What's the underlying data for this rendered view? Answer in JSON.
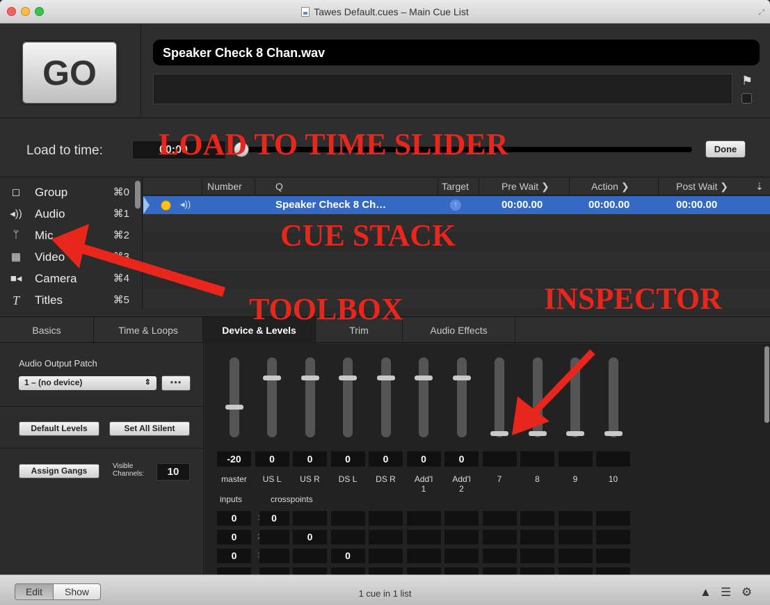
{
  "window": {
    "title": "Tawes Default.cues – Main Cue List"
  },
  "top": {
    "go_label": "GO",
    "cue_name": "Speaker Check 8 Chan.wav",
    "notes": ""
  },
  "load": {
    "label": "Load to time:",
    "time_value": "00:00",
    "slider_fraction": 0.0,
    "done_label": "Done"
  },
  "toolbox": {
    "items": [
      {
        "icon": "group-icon",
        "label": "Group",
        "shortcut": "⌘0"
      },
      {
        "icon": "audio-icon",
        "label": "Audio",
        "shortcut": "⌘1"
      },
      {
        "icon": "mic-icon",
        "label": "Mic",
        "shortcut": "⌘2"
      },
      {
        "icon": "video-icon",
        "label": "Video",
        "shortcut": "⌘3"
      },
      {
        "icon": "camera-icon",
        "label": "Camera",
        "shortcut": "⌘4"
      },
      {
        "icon": "titles-icon",
        "label": "Titles",
        "shortcut": "⌘5"
      }
    ]
  },
  "cue_stack": {
    "headers": [
      "Number",
      "Q",
      "Target",
      "Pre Wait",
      "Action",
      "Post Wait"
    ],
    "rows": [
      {
        "number": "",
        "q": "Speaker Check 8 Ch…",
        "pre_wait": "00:00.00",
        "action": "00:00.00",
        "post_wait": "00:00.00",
        "selected": true
      }
    ]
  },
  "inspector": {
    "tabs": [
      "Basics",
      "Time & Loops",
      "Device & Levels",
      "Trim",
      "Audio Effects"
    ],
    "active_tab": "Device & Levels",
    "output_patch_label": "Audio Output Patch",
    "output_patch_value": "1 – (no device)",
    "more_label": "•••",
    "default_levels_label": "Default Levels",
    "set_all_silent_label": "Set All Silent",
    "assign_gangs_label": "Assign Gangs",
    "visible_channels_label_1": "Visible",
    "visible_channels_label_2": "Channels:",
    "visible_channels_value": "10",
    "channels": [
      {
        "label": "master",
        "label2": "",
        "level": "-20",
        "thumb": 0.63
      },
      {
        "label": "US L",
        "label2": "",
        "level": "0",
        "thumb": 0.24
      },
      {
        "label": "US R",
        "label2": "",
        "level": "0",
        "thumb": 0.24
      },
      {
        "label": "DS L",
        "label2": "",
        "level": "0",
        "thumb": 0.24
      },
      {
        "label": "DS R",
        "label2": "",
        "level": "0",
        "thumb": 0.24
      },
      {
        "label": "Add'l",
        "label2": "1",
        "level": "0",
        "thumb": 0.24
      },
      {
        "label": "Add'l",
        "label2": "2",
        "level": "0",
        "thumb": 0.24
      },
      {
        "label": "7",
        "label2": "",
        "level": "",
        "thumb": 0.98
      },
      {
        "label": "8",
        "label2": "",
        "level": "",
        "thumb": 0.98
      },
      {
        "label": "9",
        "label2": "",
        "level": "",
        "thumb": 0.98
      },
      {
        "label": "10",
        "label2": "",
        "level": "",
        "thumb": 0.98
      }
    ],
    "inputs_label": "inputs",
    "crosspoints_label": "crosspoints",
    "input_rows": [
      {
        "num": "1",
        "input": "0",
        "crosspoint": "0"
      },
      {
        "num": "2",
        "input": "0",
        "crosspoint": "0"
      },
      {
        "num": "3",
        "input": "0",
        "crosspoint": "0"
      }
    ]
  },
  "footer": {
    "edit_label": "Edit",
    "show_label": "Show",
    "status": "1 cue in 1 list"
  },
  "annotations": {
    "load_to_time_slider": "LOAD TO TIME SLIDER",
    "cue_stack": "CUE STACK",
    "toolbox": "TOOLBOX",
    "inspector": "INSPECTOR"
  },
  "colors": {
    "selection_blue": "#3569c3",
    "annotation_red": "#e8261c",
    "cue_dot_yellow": "#ffc21a"
  }
}
